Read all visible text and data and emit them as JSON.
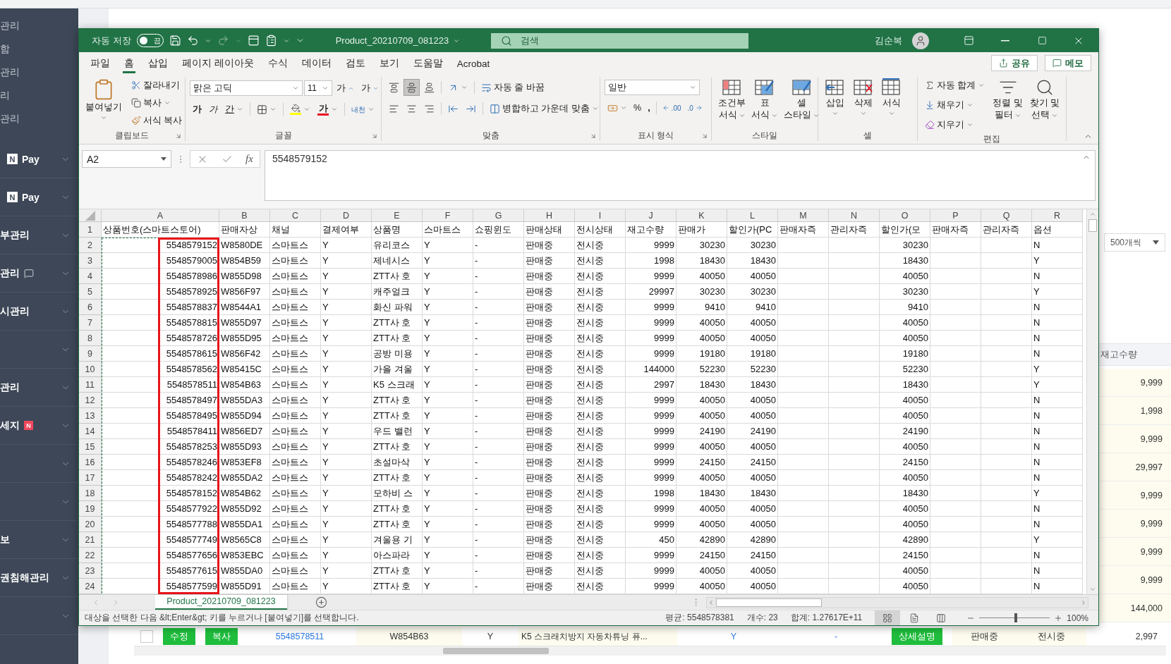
{
  "excel": {
    "title_bar": {
      "autosave_label": "자동 저장",
      "autosave_on": false,
      "autosave_state": "끔",
      "file_name": "Product_20210709_081223",
      "search_placeholder": "검색",
      "user_name": "김순복"
    },
    "menu_tabs": [
      {
        "label": "파일",
        "selected": false
      },
      {
        "label": "홈",
        "selected": true
      },
      {
        "label": "삽입",
        "selected": false
      },
      {
        "label": "페이지 레이아웃",
        "selected": false
      },
      {
        "label": "수식",
        "selected": false
      },
      {
        "label": "데이터",
        "selected": false
      },
      {
        "label": "검토",
        "selected": false
      },
      {
        "label": "보기",
        "selected": false
      },
      {
        "label": "도움말",
        "selected": false
      },
      {
        "label": "Acrobat",
        "selected": false
      }
    ],
    "share_label": "공유",
    "memo_label": "메모",
    "ribbon": {
      "clipboard": {
        "label": "클립보드",
        "paste": "붙여넣기",
        "cut": "잘라내기",
        "copy": "복사",
        "format_painter": "서식 복사"
      },
      "font": {
        "label": "글꼴",
        "font_name": "맑은 고딕",
        "font_size": "11",
        "grow": "가",
        "shrink": "가",
        "bold": "가",
        "italic": "가",
        "underline": "간",
        "font_color": "가",
        "phonetic": "내천"
      },
      "alignment": {
        "label": "맞춤",
        "vertical": [
          {
            "selected": false
          },
          {
            "selected": true
          },
          {
            "selected": false
          }
        ],
        "wrap_text": "자동 줄 바꿈",
        "merge_center": "병합하고 가운데 맞춤"
      },
      "number": {
        "label": "표시 형식",
        "format": "일반",
        "percent": "%",
        "comma": ",",
        "add_decimal": ".00",
        "remove_decimal": ".0"
      },
      "styles": {
        "label": "스타일",
        "conditional": [
          "조건부",
          "서식"
        ],
        "table": [
          "표",
          "서식"
        ],
        "cell_styles": [
          "셀",
          "스타일"
        ]
      },
      "cells": {
        "label": "셀",
        "insert": "삽입",
        "delete": "삭제",
        "format": "서식"
      },
      "editing": {
        "label": "편집",
        "autosum": "자동 합계",
        "fill": "채우기",
        "clear": "지우기",
        "sort_filter": [
          "정렬 및",
          "필터"
        ],
        "find_select": [
          "찾기 및",
          "선택"
        ]
      }
    },
    "formula_bar": {
      "name_box": "A2",
      "function_label": "fx",
      "value": "5548579152"
    },
    "sheet": {
      "header_row": "1",
      "columns": [
        {
          "letter": "A",
          "header": "상품번호(스마트스토어)",
          "kind": "number",
          "highlighted": true,
          "marquee": true
        },
        {
          "letter": "B",
          "header": "판매자상",
          "kind": "text",
          "highlighted": false,
          "marquee": false
        },
        {
          "letter": "C",
          "header": "채널",
          "kind": "text",
          "highlighted": false,
          "marquee": false
        },
        {
          "letter": "D",
          "header": "결제여부",
          "kind": "text",
          "highlighted": false,
          "marquee": false
        },
        {
          "letter": "E",
          "header": "상품명",
          "kind": "text",
          "highlighted": false,
          "marquee": false
        },
        {
          "letter": "F",
          "header": "스마트스",
          "kind": "text",
          "highlighted": false,
          "marquee": false
        },
        {
          "letter": "G",
          "header": "쇼핑윈도",
          "kind": "text",
          "highlighted": false,
          "marquee": false
        },
        {
          "letter": "H",
          "header": "판매상태",
          "kind": "text",
          "highlighted": false,
          "marquee": false
        },
        {
          "letter": "I",
          "header": "전시상태",
          "kind": "text",
          "highlighted": false,
          "marquee": false
        },
        {
          "letter": "J",
          "header": "재고수량",
          "kind": "number",
          "highlighted": false,
          "marquee": false
        },
        {
          "letter": "K",
          "header": "판매가",
          "kind": "number",
          "highlighted": false,
          "marquee": false
        },
        {
          "letter": "L",
          "header": "할인가(PC",
          "kind": "number",
          "highlighted": false,
          "marquee": false
        },
        {
          "letter": "M",
          "header": "판매자즉",
          "kind": "text",
          "highlighted": false,
          "marquee": false
        },
        {
          "letter": "N",
          "header": "관리자즉",
          "kind": "text",
          "highlighted": false,
          "marquee": false
        },
        {
          "letter": "O",
          "header": "할인가(모",
          "kind": "number",
          "highlighted": false,
          "marquee": false
        },
        {
          "letter": "P",
          "header": "판매자즉",
          "kind": "text",
          "highlighted": false,
          "marquee": false
        },
        {
          "letter": "Q",
          "header": "관리자즉",
          "kind": "text",
          "highlighted": false,
          "marquee": false
        },
        {
          "letter": "R",
          "header": "옵션",
          "kind": "text",
          "highlighted": false,
          "marquee": false
        }
      ],
      "rows": [
        {
          "number": "2",
          "cells": {
            "A": "5548579152",
            "B": "W8580DE",
            "C": "스마트스",
            "D": "Y",
            "E": "유리코스",
            "F": "Y",
            "G": "-",
            "H": "판매중",
            "I": "전시중",
            "J": "9999",
            "K": "30230",
            "L": "30230",
            "O": "30230",
            "R": "N"
          }
        },
        {
          "number": "3",
          "cells": {
            "A": "5548579005",
            "B": "W854B59",
            "C": "스마트스",
            "D": "Y",
            "E": "제네시스",
            "F": "Y",
            "G": "-",
            "H": "판매중",
            "I": "전시중",
            "J": "1998",
            "K": "18430",
            "L": "18430",
            "O": "18430",
            "R": "Y"
          }
        },
        {
          "number": "4",
          "cells": {
            "A": "5548578986",
            "B": "W855D98",
            "C": "스마트스",
            "D": "Y",
            "E": "ZTT사 호",
            "F": "Y",
            "G": "-",
            "H": "판매중",
            "I": "전시중",
            "J": "9999",
            "K": "40050",
            "L": "40050",
            "O": "40050",
            "R": "N"
          }
        },
        {
          "number": "5",
          "cells": {
            "A": "5548578925",
            "B": "W856F97",
            "C": "스마트스",
            "D": "Y",
            "E": "캐주얼크",
            "F": "Y",
            "G": "-",
            "H": "판매중",
            "I": "전시중",
            "J": "29997",
            "K": "30230",
            "L": "30230",
            "O": "30230",
            "R": "Y"
          }
        },
        {
          "number": "6",
          "cells": {
            "A": "5548578837",
            "B": "W8544A1",
            "C": "스마트스",
            "D": "Y",
            "E": "화신 파워",
            "F": "Y",
            "G": "-",
            "H": "판매중",
            "I": "전시중",
            "J": "9999",
            "K": "9410",
            "L": "9410",
            "O": "9410",
            "R": "N"
          }
        },
        {
          "number": "7",
          "cells": {
            "A": "5548578815",
            "B": "W855D97",
            "C": "스마트스",
            "D": "Y",
            "E": "ZTT사 호",
            "F": "Y",
            "G": "-",
            "H": "판매중",
            "I": "전시중",
            "J": "9999",
            "K": "40050",
            "L": "40050",
            "O": "40050",
            "R": "N"
          }
        },
        {
          "number": "8",
          "cells": {
            "A": "5548578726",
            "B": "W855D95",
            "C": "스마트스",
            "D": "Y",
            "E": "ZTT사 호",
            "F": "Y",
            "G": "-",
            "H": "판매중",
            "I": "전시중",
            "J": "9999",
            "K": "40050",
            "L": "40050",
            "O": "40050",
            "R": "N"
          }
        },
        {
          "number": "9",
          "cells": {
            "A": "5548578615",
            "B": "W856F42",
            "C": "스마트스",
            "D": "Y",
            "E": "공방 미용",
            "F": "Y",
            "G": "-",
            "H": "판매중",
            "I": "전시중",
            "J": "9999",
            "K": "19180",
            "L": "19180",
            "O": "19180",
            "R": "N"
          }
        },
        {
          "number": "10",
          "cells": {
            "A": "5548578562",
            "B": "W85415C",
            "C": "스마트스",
            "D": "Y",
            "E": "가을 겨울",
            "F": "Y",
            "G": "-",
            "H": "판매중",
            "I": "전시중",
            "J": "144000",
            "K": "52230",
            "L": "52230",
            "O": "52230",
            "R": "Y"
          }
        },
        {
          "number": "11",
          "cells": {
            "A": "5548578511",
            "B": "W854B63",
            "C": "스마트스",
            "D": "Y",
            "E": "K5 스크래",
            "F": "Y",
            "G": "-",
            "H": "판매중",
            "I": "전시중",
            "J": "2997",
            "K": "18430",
            "L": "18430",
            "O": "18430",
            "R": "Y"
          }
        },
        {
          "number": "12",
          "cells": {
            "A": "5548578497",
            "B": "W855DA3",
            "C": "스마트스",
            "D": "Y",
            "E": "ZTT사 호",
            "F": "Y",
            "G": "-",
            "H": "판매중",
            "I": "전시중",
            "J": "9999",
            "K": "40050",
            "L": "40050",
            "O": "40050",
            "R": "N"
          }
        },
        {
          "number": "13",
          "cells": {
            "A": "5548578495",
            "B": "W855D94",
            "C": "스마트스",
            "D": "Y",
            "E": "ZTT사 호",
            "F": "Y",
            "G": "-",
            "H": "판매중",
            "I": "전시중",
            "J": "9999",
            "K": "40050",
            "L": "40050",
            "O": "40050",
            "R": "N"
          }
        },
        {
          "number": "14",
          "cells": {
            "A": "5548578411",
            "B": "W856ED7",
            "C": "스마트스",
            "D": "Y",
            "E": "우드 밸런",
            "F": "Y",
            "G": "-",
            "H": "판매중",
            "I": "전시중",
            "J": "9999",
            "K": "24190",
            "L": "24190",
            "O": "24190",
            "R": "N"
          }
        },
        {
          "number": "15",
          "cells": {
            "A": "5548578253",
            "B": "W855D93",
            "C": "스마트스",
            "D": "Y",
            "E": "ZTT사 호",
            "F": "Y",
            "G": "-",
            "H": "판매중",
            "I": "전시중",
            "J": "9999",
            "K": "40050",
            "L": "40050",
            "O": "40050",
            "R": "N"
          }
        },
        {
          "number": "16",
          "cells": {
            "A": "5548578246",
            "B": "W853EF8",
            "C": "스마트스",
            "D": "Y",
            "E": "초설마삭",
            "F": "Y",
            "G": "-",
            "H": "판매중",
            "I": "전시중",
            "J": "9999",
            "K": "24150",
            "L": "24150",
            "O": "24150",
            "R": "N"
          }
        },
        {
          "number": "17",
          "cells": {
            "A": "5548578242",
            "B": "W855DA2",
            "C": "스마트스",
            "D": "Y",
            "E": "ZTT사 호",
            "F": "Y",
            "G": "-",
            "H": "판매중",
            "I": "전시중",
            "J": "9999",
            "K": "40050",
            "L": "40050",
            "O": "40050",
            "R": "N"
          }
        },
        {
          "number": "18",
          "cells": {
            "A": "5548578152",
            "B": "W854B62",
            "C": "스마트스",
            "D": "Y",
            "E": "모하비 스",
            "F": "Y",
            "G": "-",
            "H": "판매중",
            "I": "전시중",
            "J": "1998",
            "K": "18430",
            "L": "18430",
            "O": "18430",
            "R": "Y"
          }
        },
        {
          "number": "19",
          "cells": {
            "A": "5548577922",
            "B": "W855D92",
            "C": "스마트스",
            "D": "Y",
            "E": "ZTT사 호",
            "F": "Y",
            "G": "-",
            "H": "판매중",
            "I": "전시중",
            "J": "9999",
            "K": "40050",
            "L": "40050",
            "O": "40050",
            "R": "N"
          }
        },
        {
          "number": "20",
          "cells": {
            "A": "5548577788",
            "B": "W855DA1",
            "C": "스마트스",
            "D": "Y",
            "E": "ZTT사 호",
            "F": "Y",
            "G": "-",
            "H": "판매중",
            "I": "전시중",
            "J": "9999",
            "K": "40050",
            "L": "40050",
            "O": "40050",
            "R": "N"
          }
        },
        {
          "number": "21",
          "cells": {
            "A": "5548577749",
            "B": "W8565C8",
            "C": "스마트스",
            "D": "Y",
            "E": "겨울용 기",
            "F": "Y",
            "G": "-",
            "H": "판매중",
            "I": "전시중",
            "J": "450",
            "K": "42890",
            "L": "42890",
            "O": "42890",
            "R": "Y"
          }
        },
        {
          "number": "22",
          "cells": {
            "A": "5548577656",
            "B": "W853EBC",
            "C": "스마트스",
            "D": "Y",
            "E": "아스파라",
            "F": "Y",
            "G": "-",
            "H": "판매중",
            "I": "전시중",
            "J": "9999",
            "K": "24150",
            "L": "24150",
            "O": "24150",
            "R": "N"
          }
        },
        {
          "number": "23",
          "cells": {
            "A": "5548577615",
            "B": "W855DA0",
            "C": "스마트스",
            "D": "Y",
            "E": "ZTT사 호",
            "F": "Y",
            "G": "-",
            "H": "판매중",
            "I": "전시중",
            "J": "9999",
            "K": "40050",
            "L": "40050",
            "O": "40050",
            "R": "N"
          }
        },
        {
          "number": "24",
          "cells": {
            "A": "5548577599",
            "B": "W855D91",
            "C": "스마트스",
            "D": "Y",
            "E": "ZTT사 호",
            "F": "Y",
            "G": "-",
            "H": "판매중",
            "I": "전시중",
            "J": "9999",
            "K": "40050",
            "L": "40050",
            "O": "40050",
            "R": "N"
          }
        }
      ]
    },
    "sheet_tabs": [
      {
        "label": "Product_20210709_081223",
        "selected": true
      }
    ],
    "status_bar": {
      "message": "대상을 선택한 다음 &lt;Enter&gt; 키를 누르거나 [붙여넣기]를 선택합니다.",
      "average": "평균: 5548578381",
      "count": "개수: 23",
      "sum": "합계: 1.27617E+11",
      "views": [
        {
          "selected": true
        },
        {
          "selected": false
        },
        {
          "selected": false
        }
      ],
      "zoom_slider": {
        "level": 0.52
      },
      "zoom": "100%"
    }
  },
  "page": {
    "sidebar": {
      "items": [
        {
          "kind": "plain",
          "label": "관리"
        },
        {
          "kind": "plain",
          "label": "함"
        },
        {
          "kind": "plain",
          "label": "관리"
        },
        {
          "kind": "plain",
          "label": "리"
        },
        {
          "kind": "plain",
          "label": "관리"
        },
        {
          "kind": "pay",
          "logo": "N",
          "label": "Pay"
        },
        {
          "kind": "pay",
          "logo": "N",
          "label": "Pay"
        },
        {
          "kind": "menu",
          "label": "부관리"
        },
        {
          "kind": "menu-chat",
          "label": "관리"
        },
        {
          "kind": "menu",
          "label": "시관리"
        },
        {
          "kind": "menu"
        },
        {
          "kind": "menu",
          "label": "관리"
        },
        {
          "kind": "menu",
          "label": "세지",
          "badge": "N"
        },
        {
          "kind": "menu"
        },
        {
          "kind": "menu"
        },
        {
          "kind": "menu",
          "label": "보"
        },
        {
          "kind": "menu",
          "label": "권침해관리"
        },
        {
          "kind": "menu"
        }
      ]
    },
    "page_size": "500개씩",
    "stock_header": "재고수량",
    "stock_values": [
      "9,999",
      "1,998",
      "9,999",
      "29,997",
      "9,999",
      "9,999",
      "9,999",
      "9,999",
      "144,000"
    ],
    "bottom_row": {
      "checked": false,
      "edit": "수정",
      "copy": "복사",
      "product_id": "5548578511",
      "seller_code": "W854B63",
      "payment": "Y",
      "name": "K5 스크래치방지 자동차튜닝 퓨...",
      "smartstore": "Y",
      "shopping_window": "-",
      "detail": "상세설명",
      "sale_status": "판매중",
      "display_status": "전시중",
      "stock": "2,997"
    }
  }
}
